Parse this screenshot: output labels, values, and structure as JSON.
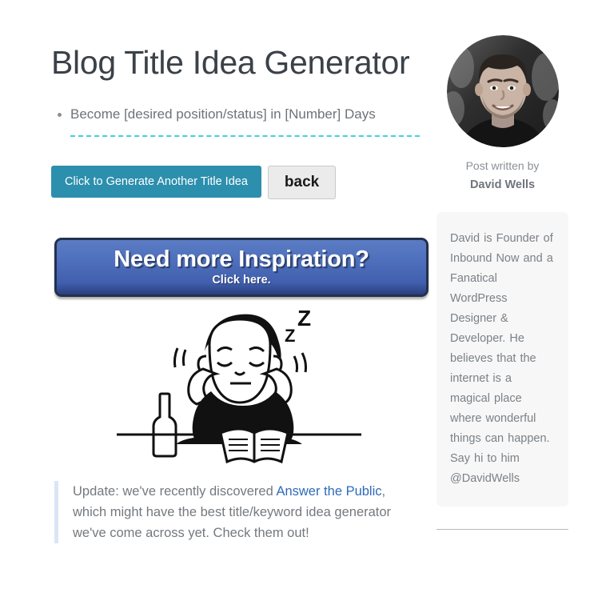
{
  "header": {
    "title": "Blog Title Idea Generator"
  },
  "main": {
    "idea": "Become [desired position/status] in [Number] Days",
    "generate_label": "Click to Generate Another Title Idea",
    "back_label": "back",
    "banner": {
      "title": "Need more Inspiration?",
      "subtitle": "Click here."
    },
    "illustration_alt": "person sleeping over an open book with Z Z Z",
    "update": {
      "prefix": "Update: we've recently discovered ",
      "link_text": "Answer the Public",
      "suffix": ", which might have the best title/keyword idea generator we've come across yet. Check them out!"
    }
  },
  "sidebar": {
    "byline": "Post written by",
    "author": "David Wells",
    "bio": "David is Founder of Inbound Now and a Fanatical WordPress Designer & Developer. He believes that the internet is a magical place where wonderful things can happen. Say hi to him @DavidWells"
  },
  "colors": {
    "title": "#3b4148",
    "accent_teal": "#2c8fad",
    "dashed_cyan": "#3fd2dd",
    "banner_blue": "#4c6dba",
    "banner_border": "#23314f",
    "link_blue": "#2e6bb8",
    "body_text": "#74797e",
    "quote_bar": "#d9e6f5",
    "bio_bg": "#f7f7f7"
  }
}
